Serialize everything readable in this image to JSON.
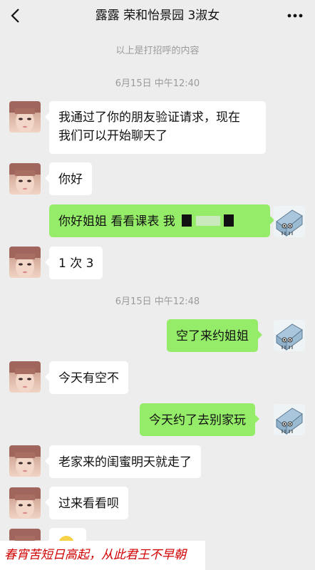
{
  "header": {
    "title": "露露 荣和怡景园 3淑女"
  },
  "greeting_note": "以上是打招呼的内容",
  "timestamps": [
    "6月15日 中午12:40",
    "6月15日 中午12:48"
  ],
  "messages": [
    {
      "side": "in",
      "line1": "我通过了你的朋友验证请求，现在",
      "line2": "我们可以开始聊天了"
    },
    {
      "side": "in",
      "text": "你好"
    },
    {
      "side": "out",
      "text": "你好姐姐 看看课表 我"
    },
    {
      "side": "in",
      "text": "1 次 3"
    },
    {
      "side": "out",
      "text": "空了来约姐姐"
    },
    {
      "side": "in",
      "text": "今天有空不"
    },
    {
      "side": "out",
      "text": "今天约了去别家玩"
    },
    {
      "side": "in",
      "text": "老家来的闺蜜明天就走了"
    },
    {
      "side": "in",
      "text": "过来看看呗"
    },
    {
      "side": "in",
      "text": ""
    }
  ],
  "footer_text": "春宵苦短日高起，从此君王不早朝",
  "colors": {
    "background": "#ededed",
    "incoming_bubble": "#ffffff",
    "outgoing_bubble": "#95ec69",
    "footer_text": "#d10000"
  },
  "icons": {
    "back": "chevron-left-icon",
    "more": "more-dots-icon"
  }
}
